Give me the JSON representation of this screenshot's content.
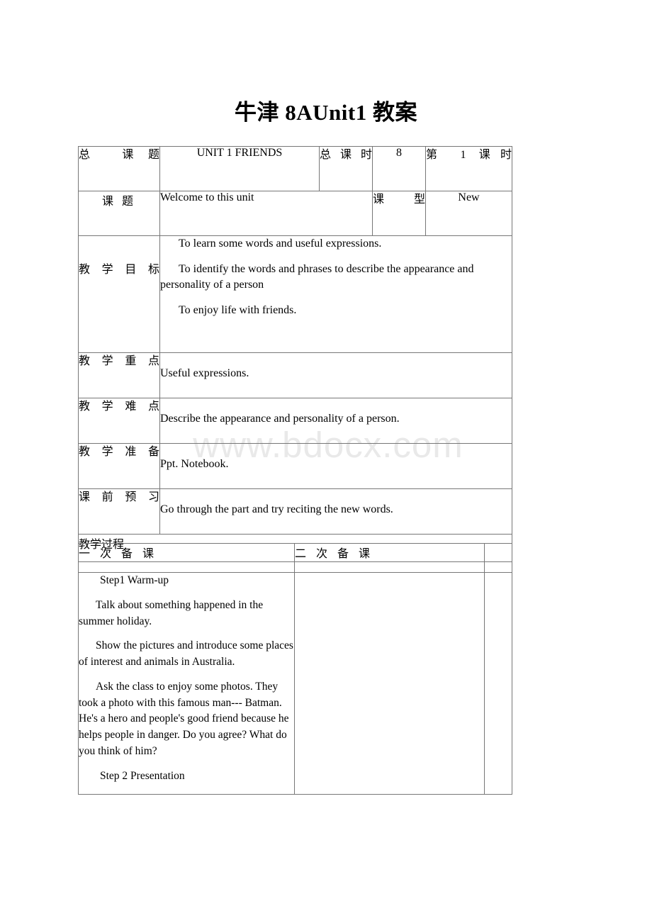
{
  "document": {
    "title": "牛津 8AUnit1 教案",
    "watermark": "www.bdocx.com"
  },
  "main_table": {
    "row_total_topic": {
      "label": "总 课题",
      "value": "UNIT 1 FRIENDS",
      "periods_label": "总课时",
      "periods_value": "8",
      "current_label": "第 1 课时"
    },
    "row_topic": {
      "label": "课 题",
      "value": "Welcome to this unit",
      "type_label": "课型",
      "type_value": "New"
    },
    "row_objectives": {
      "label": "教学目标",
      "items": [
        "To learn some words and useful expressions.",
        "To identify the words and phrases to describe the appearance and personality of a person",
        "To enjoy life with friends."
      ]
    },
    "row_key_points": {
      "label": "教学重点",
      "value": "Useful expressions."
    },
    "row_difficult_points": {
      "label": "教学难点",
      "value": "Describe the appearance and personality of a person."
    },
    "row_preparation": {
      "label": "教学准备",
      "value": "Ppt. Notebook."
    },
    "row_preview": {
      "label": "课前预习",
      "value": "Go through the part and try reciting the new words."
    },
    "row_process": {
      "label": "教学过程"
    }
  },
  "bottom_table": {
    "headers": {
      "first_preparation": "一 次 备 课",
      "second_preparation": "二 次 备 课",
      "third": ""
    },
    "content": {
      "paragraphs": [
        "Step1  Warm-up",
        "Talk about something happened in the summer holiday.",
        "Show the pictures and introduce some places of interest and animals in Australia.",
        "Ask the class to enjoy some photos. They took a photo with this famous man--- Batman. He's a hero and people's good friend because he helps people in danger. Do you agree? What do you think of him?",
        "Step 2  Presentation"
      ]
    }
  }
}
